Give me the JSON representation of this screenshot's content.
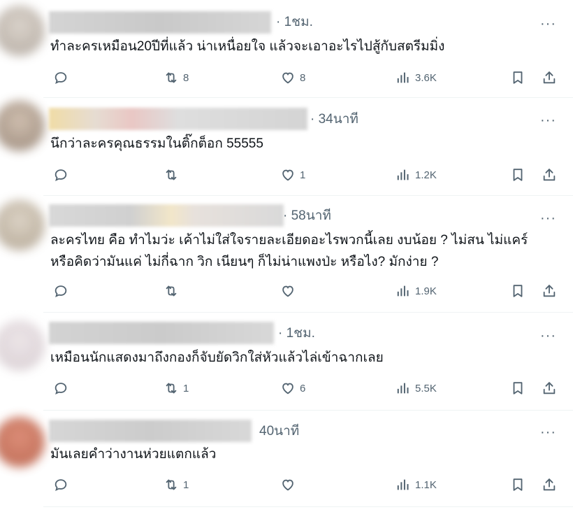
{
  "posts": [
    {
      "time": "· 1ชม.",
      "lines": [
        "ทำละครเหมือน20ปีที่แล้ว น่าเหนื่อยใจ แล้วจะเอาอะไรไปสู้กับสตรีมมิ่ง"
      ],
      "replies": "",
      "reposts": "8",
      "likes": "8",
      "views": "3.6K"
    },
    {
      "time": "· 34นาที",
      "lines": [
        "นึกว่าละครคุณธรรมในติ๊กต็อก 55555"
      ],
      "replies": "",
      "reposts": "",
      "likes": "1",
      "views": "1.2K"
    },
    {
      "time": "· 58นาที",
      "lines": [
        "ละครไทย คือ ทำไมว่ะ เค้าไม่ใส่ใจรายละเอียดอะไรพวกนี้เลย งบน้อย ? ไม่สน ไม่แคร์",
        "หรือคิดว่ามันแค่ ไม่กี่ฉาก วิก เนียนๆ ก็ไม่น่าแพงป่ะ หรือไง? มักง่าย ?"
      ],
      "replies": "",
      "reposts": "",
      "likes": "",
      "views": "1.9K"
    },
    {
      "time": "· 1ชม.",
      "lines": [
        "เหมือนนักแสดงมาถึงกองก็จับยัดวิกใส่หัวแล้วไล่เข้าฉากเลย"
      ],
      "replies": "",
      "reposts": "1",
      "likes": "6",
      "views": "5.5K"
    },
    {
      "time": "40นาที",
      "lines": [
        "มันเลยคำว่างานห่วยแตกแล้ว"
      ],
      "replies": "",
      "reposts": "1",
      "likes": "",
      "views": "1.1K"
    }
  ],
  "icons": {
    "reply": "reply-icon",
    "repost": "repost-icon",
    "like": "like-icon",
    "views": "views-icon",
    "bookmark": "bookmark-icon",
    "share": "share-icon",
    "more": "more-icon"
  },
  "colors": {
    "text": "#0f1419",
    "secondary": "#536471",
    "divider": "#eff3f4"
  }
}
